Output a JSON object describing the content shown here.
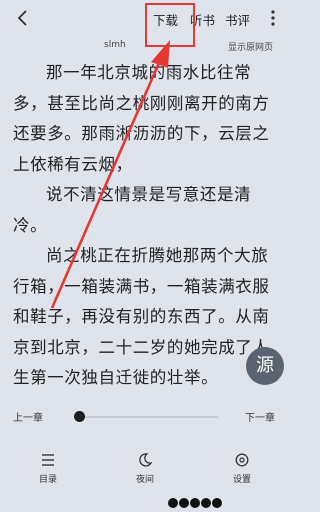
{
  "topbar": {
    "download_label": "下载",
    "listen_label": "听书",
    "review_label": "书评"
  },
  "meta": {
    "source_name": "slmh",
    "show_original_label": "显示原网页"
  },
  "paragraphs": [
    "那一年北京城的雨水比往常多，甚至比尚之桃刚刚离开的南方还要多。那雨淅沥沥的下，云层之上依稀有云烟，",
    "说不清这情景是写意还是清冷。",
    "尚之桃正在折腾她那两个大旅行箱，一箱装满书，一箱装满衣服和鞋子，再没有别的东西了。从南京到北京，二十二岁的她完成了人生第一次独自迁徙的壮举。"
  ],
  "source_button_label": "源",
  "progress": {
    "prev_chapter_label": "上一章",
    "next_chapter_label": "下一章",
    "position_fraction": 0.0
  },
  "bottom_nav": {
    "catalog_label": "目录",
    "night_label": "夜间",
    "settings_label": "设置"
  },
  "annotation": {
    "box_color": "#e53935",
    "arrow_color": "#e53935"
  }
}
